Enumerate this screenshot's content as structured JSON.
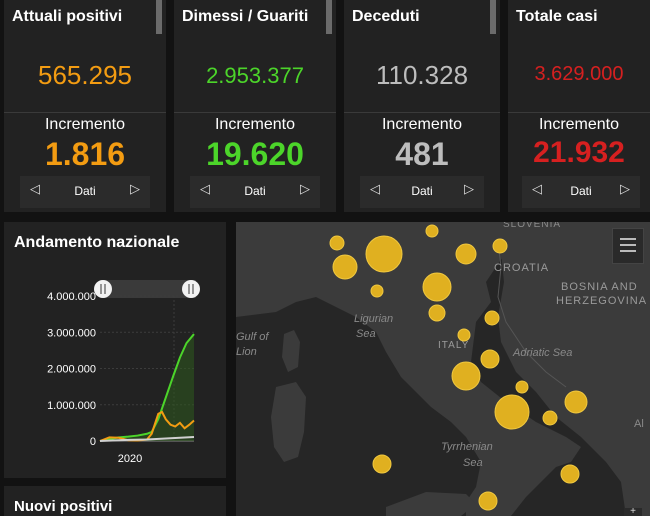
{
  "cards": [
    {
      "title": "Attuali positivi",
      "value": "565.295",
      "increment_label": "Incremento",
      "increment": "1.816",
      "color": "#f39c12",
      "pager_label": "Dati"
    },
    {
      "title": "Dimessi / Guariti",
      "value": "2.953.377",
      "increment_label": "Incremento",
      "increment": "19.620",
      "color": "#4cd52a",
      "pager_label": "Dati"
    },
    {
      "title": "Deceduti",
      "value": "110.328",
      "increment_label": "Incremento",
      "increment": "481",
      "color": "#bdbdbd",
      "pager_label": "Dati"
    },
    {
      "title": "Totale casi",
      "value": "3.629.000",
      "increment_label": "Incremento",
      "increment": "21.932",
      "color": "#d62020",
      "pager_label": "Dati"
    }
  ],
  "chart": {
    "title": "Andamento nazionale",
    "chart_data": {
      "type": "line",
      "ylim": [
        0,
        4000000
      ],
      "yticks": [
        "4.000.000",
        "3.000.000",
        "2.000.000",
        "1.000.000",
        "0"
      ],
      "xticks": [
        "2020"
      ],
      "series": [
        {
          "color": "#4cd52a",
          "x": [
            0,
            0.1,
            0.2,
            0.3,
            0.4,
            0.5,
            0.55,
            0.62,
            0.7,
            0.78,
            0.85,
            0.92,
            1.0
          ],
          "y": [
            0,
            50000,
            100000,
            120000,
            150000,
            200000,
            250000,
            600000,
            1200000,
            1800000,
            2300000,
            2700000,
            2950000
          ]
        },
        {
          "color": "#f39c12",
          "x": [
            0,
            0.1,
            0.2,
            0.3,
            0.4,
            0.5,
            0.55,
            0.62,
            0.66,
            0.7,
            0.75,
            0.8,
            0.85,
            0.9,
            0.95,
            1.0
          ],
          "y": [
            0,
            100000,
            90000,
            20000,
            15000,
            40000,
            200000,
            750000,
            800000,
            600000,
            450000,
            400000,
            500000,
            350000,
            450000,
            565000
          ],
          "line": true
        },
        {
          "color": "#d0d0d0",
          "x": [
            0,
            0.3,
            0.5,
            0.7,
            1.0
          ],
          "y": [
            0,
            30000,
            40000,
            70000,
            110000
          ]
        }
      ]
    }
  },
  "bottom_panel": {
    "title": "Nuovi positivi"
  },
  "map": {
    "labels": [
      {
        "text": "SLOVENIA"
      },
      {
        "text": "CROATIA"
      },
      {
        "text": "BOSNIA AND"
      },
      {
        "text": "HERZEGOVINA"
      },
      {
        "text": "Ligurian"
      },
      {
        "text": "Sea"
      },
      {
        "text": "Gulf of"
      },
      {
        "text": "Lion"
      },
      {
        "text": "ITALY"
      },
      {
        "text": "Adriatic Sea"
      },
      {
        "text": "Tyrrhenian"
      },
      {
        "text": "Sea"
      },
      {
        "text": "Al"
      }
    ],
    "bubble_color": "#e0b020"
  }
}
